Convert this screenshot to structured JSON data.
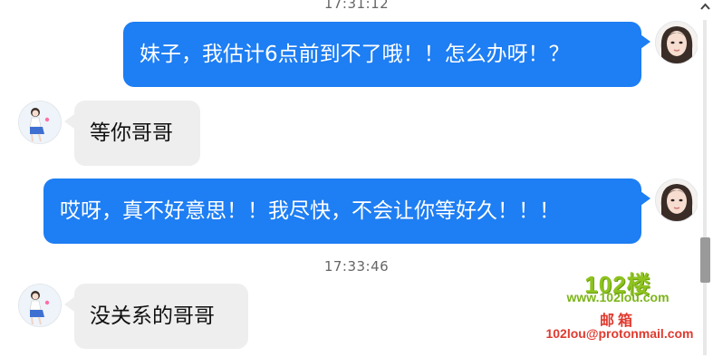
{
  "conversation": {
    "timestamps": [
      "17:31:12",
      "17:33:46"
    ],
    "messages": [
      {
        "direction": "outgoing",
        "text": "妹子，我估计6点前到不了哦！！怎么办呀！？",
        "avatar": "female-avatar-icon"
      },
      {
        "direction": "incoming",
        "text": "等你哥哥",
        "avatar": "girl-avatar-icon"
      },
      {
        "direction": "outgoing",
        "text": "哎呀，真不好意思！！我尽快，不会让你等好久！！！",
        "avatar": "female-avatar-icon"
      },
      {
        "direction": "incoming",
        "text": "没关系的哥哥",
        "avatar": "girl-avatar-icon"
      }
    ]
  },
  "watermark": {
    "logo": "102楼",
    "site": "www.102lou.com",
    "mail_label": "邮箱",
    "email": "102lou@protonmail.com"
  },
  "colors": {
    "outgoing_bubble": "#1e7ef3",
    "incoming_bubble": "#eeeeee",
    "watermark_green": "#8ec31f",
    "watermark_red": "#e03a2f"
  },
  "icons": [
    "chevron-up-icon",
    "female-avatar-icon",
    "girl-avatar-icon"
  ]
}
